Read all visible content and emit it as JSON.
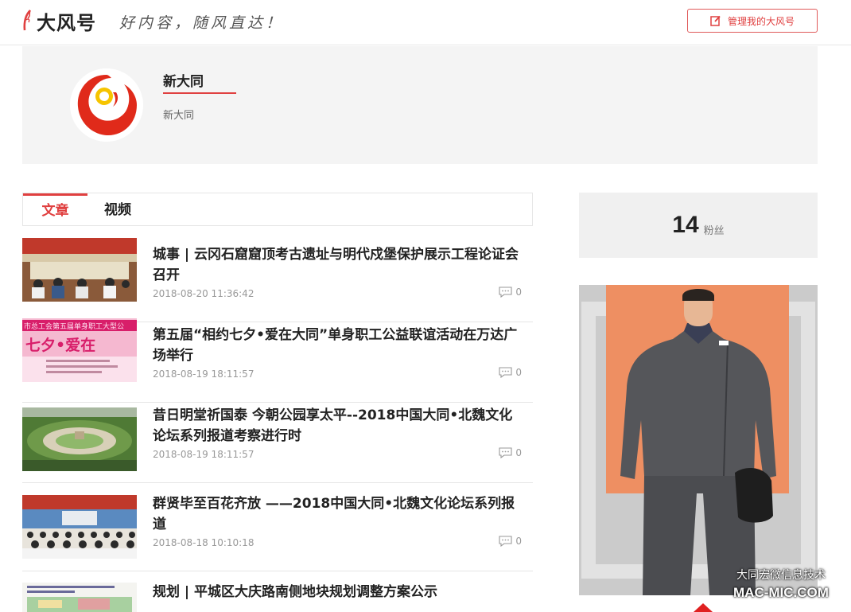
{
  "header": {
    "logo_text": "大风号",
    "slogan": "好内容，随风直达！",
    "manage_label": "管理我的大风号"
  },
  "profile": {
    "name": "新大同",
    "description": "新大同"
  },
  "tabs": [
    {
      "label": "文章",
      "active": true
    },
    {
      "label": "视频",
      "active": false
    }
  ],
  "articles": [
    {
      "title": "城事 | 云冈石窟窟顶考古遗址与明代戍堡保护展示工程论证会召开",
      "date": "2018-08-20 11:36:42",
      "comments": "0"
    },
    {
      "title": "第五届“相约七夕•爱在大同”单身职工公益联谊活动在万达广场举行",
      "date": "2018-08-19 18:11:57",
      "comments": "0",
      "thumb_text": "七夕•爱在",
      "thumb_banner": "市总工会第五届单身职工大型公"
    },
    {
      "title": "昔日明堂祈国泰 今朝公园享太平--2018中国大同•北魏文化论坛系列报道考察进行时",
      "date": "2018-08-19 18:11:57",
      "comments": "0"
    },
    {
      "title": "群贤毕至百花齐放 ——2018中国大同•北魏文化论坛系列报道",
      "date": "2018-08-18 10:10:18",
      "comments": "0"
    },
    {
      "title": "规划 | 平城区大庆路南侧地块规划调整方案公示",
      "date": "",
      "comments": ""
    }
  ],
  "fans": {
    "count": "14",
    "label": "粉丝"
  },
  "watermark": {
    "line1": "大同宏微信息技术",
    "line2": "MAC-MIC.COM"
  },
  "colors": {
    "accent": "#e04040",
    "profile_bg": "#f4f4f4",
    "fans_bg": "#f0f0f0",
    "ad_orange": "#ee8f62"
  }
}
